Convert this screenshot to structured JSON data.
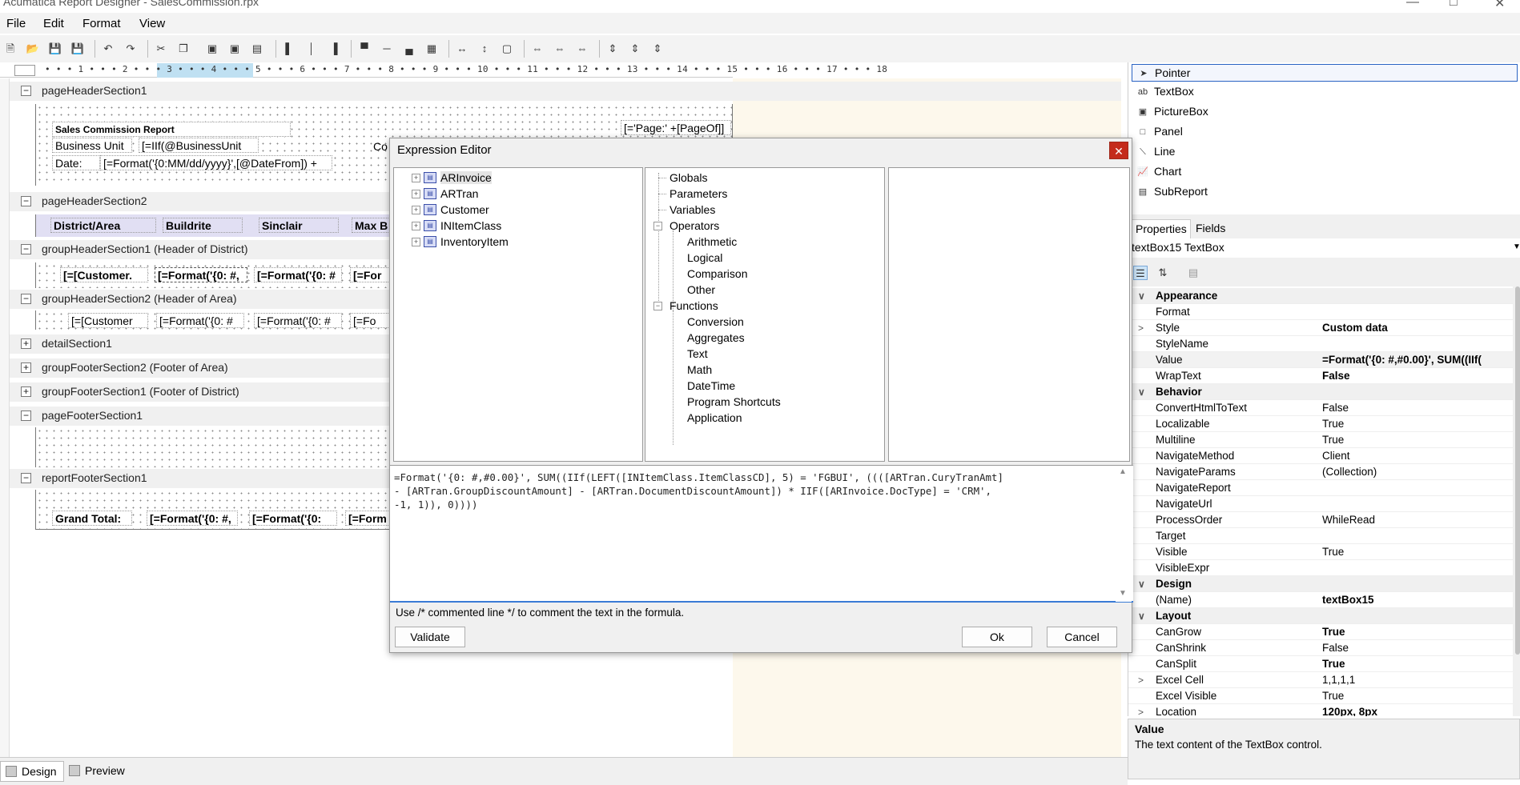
{
  "window": {
    "title": "Acumatica Report Designer - SalesCommission.rpx"
  },
  "menu": [
    "File",
    "Edit",
    "Format",
    "View"
  ],
  "ruler": {
    "marks": "• • • 1 • • • 2 • • • 3 • • • 4 • • • 5 • • • 6 • • • 7 • • • 8 • • • 9 • • • 10 • • • 11 • • • 12 • • • 13 • • • 14 • • • 15 • • • 16 • • • 17 • • • 18"
  },
  "sections": {
    "s1": "pageHeaderSection1",
    "s2": "pageHeaderSection2",
    "s3": "groupHeaderSection1 (Header of District)",
    "s4": "groupHeaderSection2 (Header of Area)",
    "s5": "detailSection1",
    "s6": "groupFooterSection2 (Footer of Area)",
    "s7": "groupFooterSection1 (Footer of District)",
    "s8": "pageFooterSection1",
    "s9": "reportFooterSection1"
  },
  "fields": {
    "report_title": "Sales Commission Report",
    "page": "[='Page:' +[PageOf]]",
    "bu_label": "Business Unit",
    "bu_value": "[=IIf(@BusinessUnit",
    "co": "Co",
    "date_label": "Date:",
    "date_value": "[=Format('{0:MM/dd/yyyy}',[@DateFrom]) +",
    "col1": "District/Area",
    "col2": "Buildrite",
    "col3": "Sinclair",
    "col4": "Max B",
    "g1a": "[=[Customer.",
    "g1b": "[=Format('{0: #,",
    "g1c": "[=Format('{0: #",
    "g1d": "[=For",
    "g2a": "[=[Customer",
    "g2b": "[=Format('{0: #",
    "g2c": "[=Format('{0: #",
    "g2d": "[=Fo",
    "grand": "Grand Total:",
    "gt1": "[=Format('{0: #,",
    "gt2": "[=Format('{0:",
    "gt3": "[=Form"
  },
  "toolbox": {
    "items": [
      "Pointer",
      "TextBox",
      "PictureBox",
      "Panel",
      "Line",
      "Chart",
      "SubReport"
    ]
  },
  "properties": {
    "tabs": [
      "Properties",
      "Fields"
    ],
    "selected": "textBox15  TextBox",
    "rows": [
      {
        "n": "Appearance",
        "v": ""
      },
      {
        "n": "Format",
        "v": ""
      },
      {
        "n": "Style",
        "v": "Custom data"
      },
      {
        "n": "StyleName",
        "v": ""
      },
      {
        "n": "Value",
        "v": "=Format('{0: #,#0.00}', SUM((IIf("
      },
      {
        "n": "WrapText",
        "v": "False"
      },
      {
        "n": "Behavior",
        "v": ""
      },
      {
        "n": "ConvertHtmlToText",
        "v": "False"
      },
      {
        "n": "Localizable",
        "v": "True"
      },
      {
        "n": "Multiline",
        "v": "True"
      },
      {
        "n": "NavigateMethod",
        "v": "Client"
      },
      {
        "n": "NavigateParams",
        "v": "(Collection)"
      },
      {
        "n": "NavigateReport",
        "v": ""
      },
      {
        "n": "NavigateUrl",
        "v": ""
      },
      {
        "n": "ProcessOrder",
        "v": "WhileRead"
      },
      {
        "n": "Target",
        "v": ""
      },
      {
        "n": "Visible",
        "v": "True"
      },
      {
        "n": "VisibleExpr",
        "v": ""
      },
      {
        "n": "Design",
        "v": ""
      },
      {
        "n": "(Name)",
        "v": "textBox15"
      },
      {
        "n": "Layout",
        "v": ""
      },
      {
        "n": "CanGrow",
        "v": "True"
      },
      {
        "n": "CanShrink",
        "v": "False"
      },
      {
        "n": "CanSplit",
        "v": "True"
      },
      {
        "n": "Excel Cell",
        "v": "1,1,1,1"
      },
      {
        "n": "Excel Visible",
        "v": "True"
      },
      {
        "n": "Location",
        "v": "120px, 8px"
      }
    ],
    "help_title": "Value",
    "help_text": "The text content of the TextBox control."
  },
  "status": {
    "design": "Design",
    "preview": "Preview"
  },
  "dialog": {
    "title": "Expression Editor",
    "tables": [
      "ARInvoice",
      "ARTran",
      "Customer",
      "INItemClass",
      "InventoryItem"
    ],
    "tree": {
      "globals": "Globals",
      "parameters": "Parameters",
      "variables": "Variables",
      "operators": "Operators",
      "arith": "Arithmetic",
      "logical": "Logical",
      "comparison": "Comparison",
      "other": "Other",
      "functions": "Functions",
      "conversion": "Conversion",
      "aggregates": "Aggregates",
      "text": "Text",
      "math": "Math",
      "datetime": "DateTime",
      "shortcuts": "Program Shortcuts",
      "application": "Application"
    },
    "expression": "=Format('{0: #,#0.00}', SUM((IIf(LEFT([INItemClass.ItemClassCD], 5) = 'FGBUI', ((([ARTran.CuryTranAmt]\n- [ARTran.GroupDiscountAmount] - [ARTran.DocumentDiscountAmount]) * IIF([ARInvoice.DocType] = 'CRM',\n-1, 1)), 0))))",
    "hint": "Use /* commented line */ to comment the text in the formula.",
    "validate": "Validate",
    "ok": "Ok",
    "cancel": "Cancel"
  }
}
